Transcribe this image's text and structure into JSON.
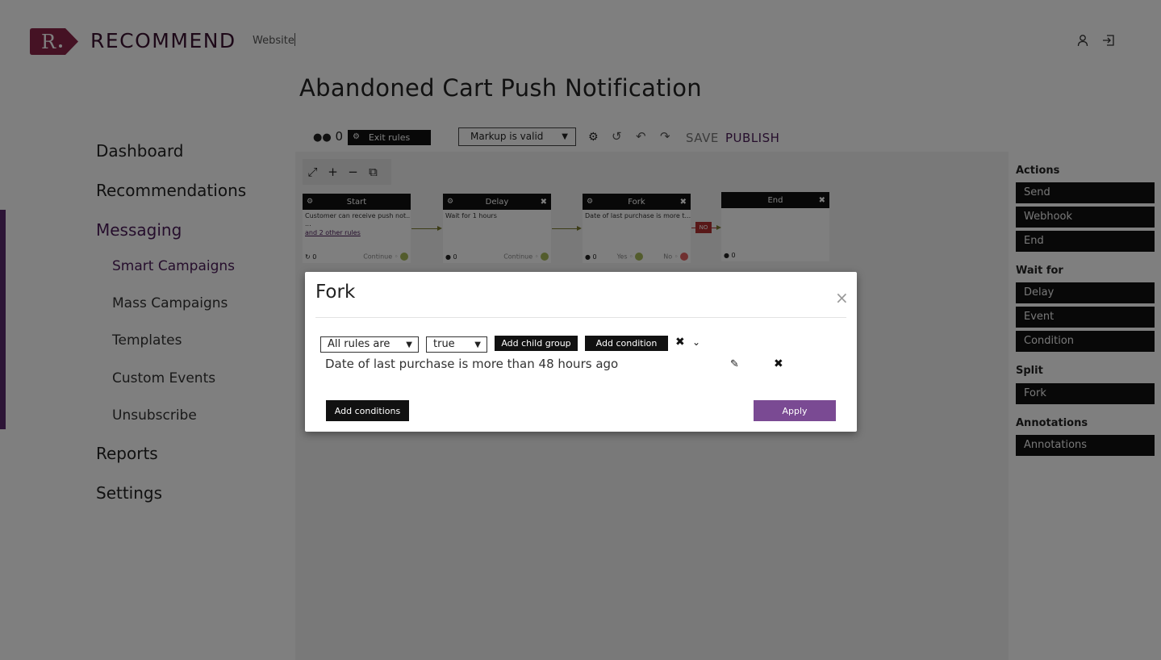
{
  "header": {
    "logo_letter": "R",
    "logo_text": "RECOMMEND",
    "website_link": "Website"
  },
  "page": {
    "title": "Abandoned Cart Push Notification"
  },
  "sidebar": {
    "items": [
      {
        "label": "Dashboard"
      },
      {
        "label": "Recommendations"
      },
      {
        "label": "Messaging"
      },
      {
        "label": "Smart Campaigns"
      },
      {
        "label": "Mass Campaigns"
      },
      {
        "label": "Templates"
      },
      {
        "label": "Custom Events"
      },
      {
        "label": "Unsubscribe"
      },
      {
        "label": "Reports"
      },
      {
        "label": "Settings"
      }
    ]
  },
  "toolbar": {
    "users_count": "0",
    "exit_rules": "Exit rules",
    "markup_status": "Markup is valid",
    "save": "SAVE",
    "publish": "PUBLISH"
  },
  "canvas": {
    "nodes": [
      {
        "title": "Start",
        "body": "Customer can receive push not...",
        "extra": "...",
        "link": "and 2 other rules",
        "count": "0",
        "out1": "Continue"
      },
      {
        "title": "Delay",
        "body": "Wait for 1 hours",
        "count": "0",
        "out1": "Continue"
      },
      {
        "title": "Fork",
        "body": "Date of last purchase is more t...",
        "count": "0",
        "out1": "Yes",
        "out2": "No"
      },
      {
        "title": "End",
        "count": "0"
      }
    ],
    "no_label": "NO"
  },
  "palette": {
    "sections": [
      {
        "title": "Actions",
        "items": [
          "Send",
          "Webhook",
          "End"
        ]
      },
      {
        "title": "Wait for",
        "items": [
          "Delay",
          "Event",
          "Condition"
        ]
      },
      {
        "title": "Split",
        "items": [
          "Fork"
        ]
      },
      {
        "title": "Annotations",
        "items": [
          "Annotations"
        ]
      }
    ]
  },
  "modal": {
    "title": "Fork",
    "close": "×",
    "rule_mode": "All rules are",
    "rule_value": "true",
    "add_child_group": "Add child group",
    "add_condition": "Add condition",
    "condition_text": "Date of last purchase is more than 48 hours ago",
    "add_conditions": "Add conditions",
    "apply": "Apply"
  },
  "colors": {
    "brand": "#8b2448",
    "accent_purple": "#4a1b58",
    "apply_button": "#7a4a93",
    "continue_dot": "#a6b85a",
    "no_dot": "#e06060",
    "no_badge": "#b03030"
  }
}
